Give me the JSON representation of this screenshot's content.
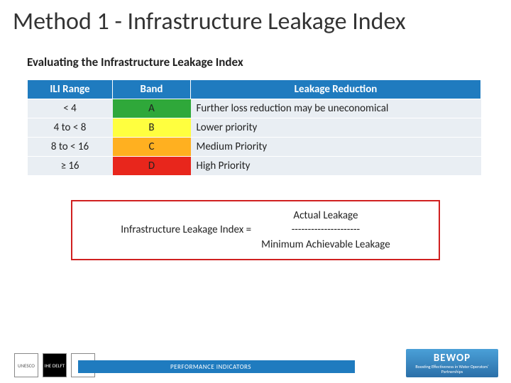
{
  "title": "Method 1 - Infrastructure Leakage Index",
  "subtitle": "Evaluating the Infrastructure Leakage Index",
  "table": {
    "headers": {
      "range": "ILI Range",
      "band": "Band",
      "desc": "Leakage Reduction"
    },
    "rows": [
      {
        "range": "< 4",
        "band": "A",
        "desc": "Further loss reduction may be uneconomical"
      },
      {
        "range": "4 to < 8",
        "band": "B",
        "desc": "Lower priority"
      },
      {
        "range": "8 to < 16",
        "band": "C",
        "desc": "Medium Priority"
      },
      {
        "range": "≥ 16",
        "band": "D",
        "desc": "High Priority"
      }
    ]
  },
  "formula": {
    "lhs": "Infrastructure Leakage Index =",
    "numerator": "Actual Leakage",
    "divider": "---------------------",
    "denominator": "Minimum Achievable Leakage"
  },
  "footer": {
    "caption": "PERFORMANCE INDICATORS",
    "bewop_main": "BEWOP",
    "bewop_sub": "Boosting Effectiveness in Water Operators' Partnerships",
    "logo1": "UNESCO",
    "logo2": "IHE DELFT",
    "logo3": ""
  },
  "chart_data": {
    "type": "table",
    "title": "Evaluating the Infrastructure Leakage Index",
    "columns": [
      "ILI Range",
      "Band",
      "Leakage Reduction"
    ],
    "rows": [
      [
        "< 4",
        "A",
        "Further loss reduction may be uneconomical"
      ],
      [
        "4 to < 8",
        "B",
        "Lower priority"
      ],
      [
        "8 to < 16",
        "C",
        "Medium Priority"
      ],
      [
        "≥ 16",
        "D",
        "High Priority"
      ]
    ],
    "band_colors": {
      "A": "#2fa83a",
      "B": "#ffff3f",
      "C": "#ffb020",
      "D": "#e8261c"
    }
  }
}
